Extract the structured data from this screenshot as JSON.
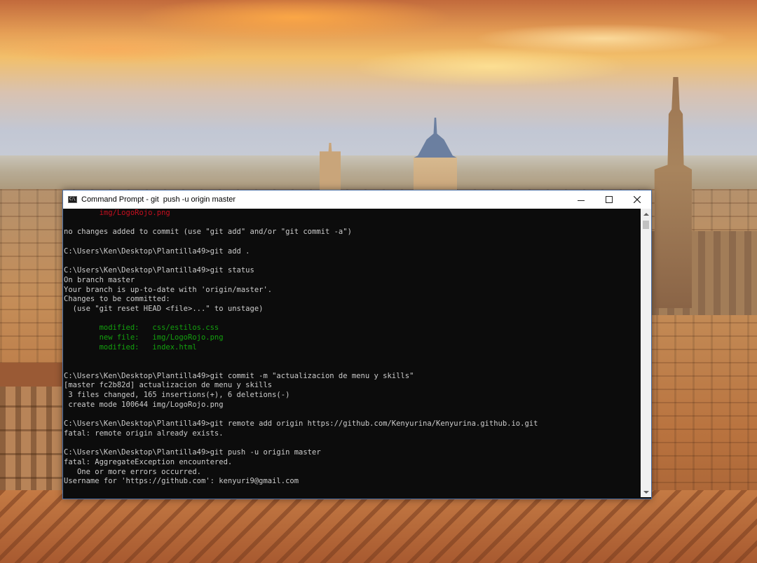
{
  "window": {
    "title": "Command Prompt - git  push -u origin master",
    "icon": "cmd-icon",
    "icon_text": "C:\\",
    "controls": [
      "minimize-icon",
      "maximize-icon",
      "close-icon"
    ]
  },
  "colors": {
    "console_bg": "#0c0c0c",
    "console_text": "#cccccc",
    "error_red": "#c50f1f",
    "staged_green": "#13a10e",
    "window_border": "#4a6fa5"
  },
  "console": {
    "lines": [
      {
        "text": "        img/LogoRojo.png",
        "color": "red"
      },
      {
        "text": ""
      },
      {
        "text": "no changes added to commit (use \"git add\" and/or \"git commit -a\")"
      },
      {
        "text": ""
      },
      {
        "text": "C:\\Users\\Ken\\Desktop\\Plantilla49>git add ."
      },
      {
        "text": ""
      },
      {
        "text": "C:\\Users\\Ken\\Desktop\\Plantilla49>git status"
      },
      {
        "text": "On branch master"
      },
      {
        "text": "Your branch is up-to-date with 'origin/master'."
      },
      {
        "text": "Changes to be committed:"
      },
      {
        "text": "  (use \"git reset HEAD <file>...\" to unstage)"
      },
      {
        "text": ""
      },
      {
        "text": "        modified:   css/estilos.css",
        "color": "green"
      },
      {
        "text": "        new file:   img/LogoRojo.png",
        "color": "green"
      },
      {
        "text": "        modified:   index.html",
        "color": "green"
      },
      {
        "text": ""
      },
      {
        "text": ""
      },
      {
        "text": "C:\\Users\\Ken\\Desktop\\Plantilla49>git commit -m \"actualizacion de menu y skills\""
      },
      {
        "text": "[master fc2b82d] actualizacion de menu y skills"
      },
      {
        "text": " 3 files changed, 165 insertions(+), 6 deletions(-)"
      },
      {
        "text": " create mode 100644 img/LogoRojo.png"
      },
      {
        "text": ""
      },
      {
        "text": "C:\\Users\\Ken\\Desktop\\Plantilla49>git remote add origin https://github.com/Kenyurina/Kenyurina.github.io.git"
      },
      {
        "text": "fatal: remote origin already exists."
      },
      {
        "text": ""
      },
      {
        "text": "C:\\Users\\Ken\\Desktop\\Plantilla49>git push -u origin master"
      },
      {
        "text": "fatal: AggregateException encountered."
      },
      {
        "text": "   One or more errors occurred."
      },
      {
        "text": "Username for 'https://github.com': kenyuri9@gmail.com"
      }
    ]
  },
  "scrollbar": {
    "up_icon": "scroll-up-arrow-icon",
    "down_icon": "scroll-down-arrow-icon",
    "position": "bottom"
  }
}
